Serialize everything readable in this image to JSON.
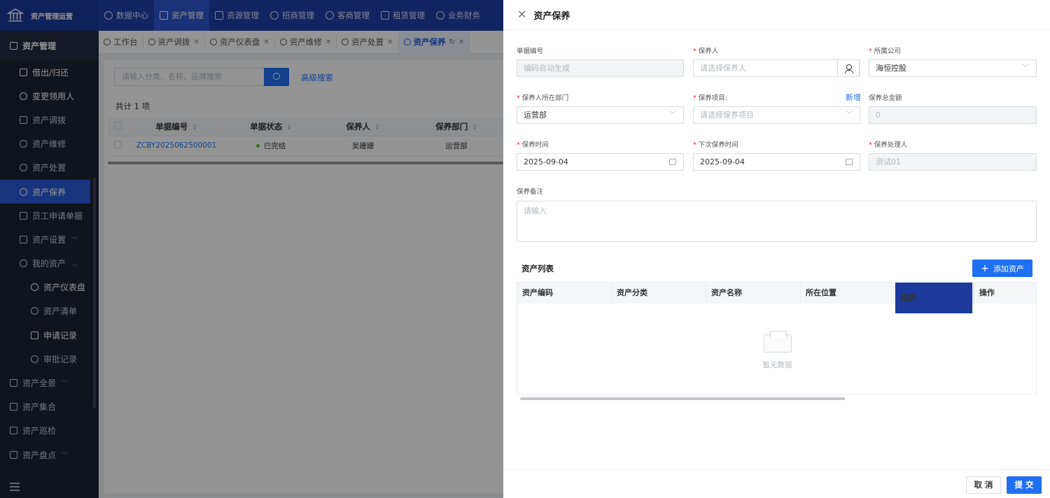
{
  "app": {
    "title": "资产管理运营"
  },
  "topnav": [
    {
      "label": "数据中心",
      "icon": "clock-icon"
    },
    {
      "label": "资产管理",
      "icon": "asset-icon"
    },
    {
      "label": "资源管理",
      "icon": "building-icon"
    },
    {
      "label": "招商管理",
      "icon": "tag-icon"
    },
    {
      "label": "客商管理",
      "icon": "people-icon"
    },
    {
      "label": "租赁管理",
      "icon": "house-icon"
    },
    {
      "label": "业务财务",
      "icon": "finance-icon"
    }
  ],
  "sidebar": {
    "title": "资产管理",
    "items": [
      {
        "label": "借出/归还"
      },
      {
        "label": "变更领用人"
      },
      {
        "label": "资产调拨"
      },
      {
        "label": "资产维修"
      },
      {
        "label": "资产处置"
      },
      {
        "label": "资产保养"
      },
      {
        "label": "员工申请单据"
      },
      {
        "label": "资产设置"
      },
      {
        "label": "我的资产"
      },
      {
        "label": "资产仪表盘"
      },
      {
        "label": "资产清单"
      },
      {
        "label": "申请记录"
      },
      {
        "label": "审批记录"
      },
      {
        "label": "资产全景"
      },
      {
        "label": "资产集合"
      },
      {
        "label": "资产巡检"
      },
      {
        "label": "资产盘点"
      }
    ]
  },
  "tabs": [
    {
      "label": "工作台"
    },
    {
      "label": "资产调拨"
    },
    {
      "label": "资产仪表盘"
    },
    {
      "label": "资产维修"
    },
    {
      "label": "资产处置"
    },
    {
      "label": "资产保养"
    }
  ],
  "list": {
    "search_placeholder": "请输入分类、名称、品牌搜索",
    "advanced_search": "高级搜索",
    "count": "共计 1 项",
    "columns": [
      "单据编号",
      "单据状态",
      "保养人",
      "保养部门"
    ],
    "rows": [
      {
        "code": "ZCBY2025062500001",
        "status": "已完结",
        "person": "吴姗姗",
        "dept": "运营部"
      }
    ]
  },
  "drawer": {
    "title": "资产保养",
    "form": {
      "doc_no": {
        "label": "单据编号",
        "placeholder": "编码自动生成"
      },
      "maintainer": {
        "label": "保养人",
        "placeholder": "请选择保养人"
      },
      "company": {
        "label": "所属公司",
        "value": "海恒控股"
      },
      "dept": {
        "label": "保养人所在部门",
        "value": "运营部"
      },
      "project": {
        "label": "保养项目:",
        "placeholder": "请选择保养项目",
        "new": "新增"
      },
      "total": {
        "label": "保养总金额",
        "value": "0"
      },
      "time": {
        "label": "保养时间",
        "value": "2025-09-04"
      },
      "next_time": {
        "label": "下次保养时间",
        "value": "2025-09-04"
      },
      "handler": {
        "label": "保养处理人",
        "value": "测试01"
      },
      "remark": {
        "label": "保养备注",
        "placeholder": "请输入"
      }
    },
    "asset_list": {
      "title": "资产列表",
      "add_button": "添加资产",
      "columns": [
        "资产编码",
        "资产分类",
        "资产名称",
        "所在位置",
        "品牌",
        "操作"
      ],
      "empty_text": "暂无数据"
    },
    "footer": {
      "cancel": "取 消",
      "submit": "提 交"
    }
  }
}
